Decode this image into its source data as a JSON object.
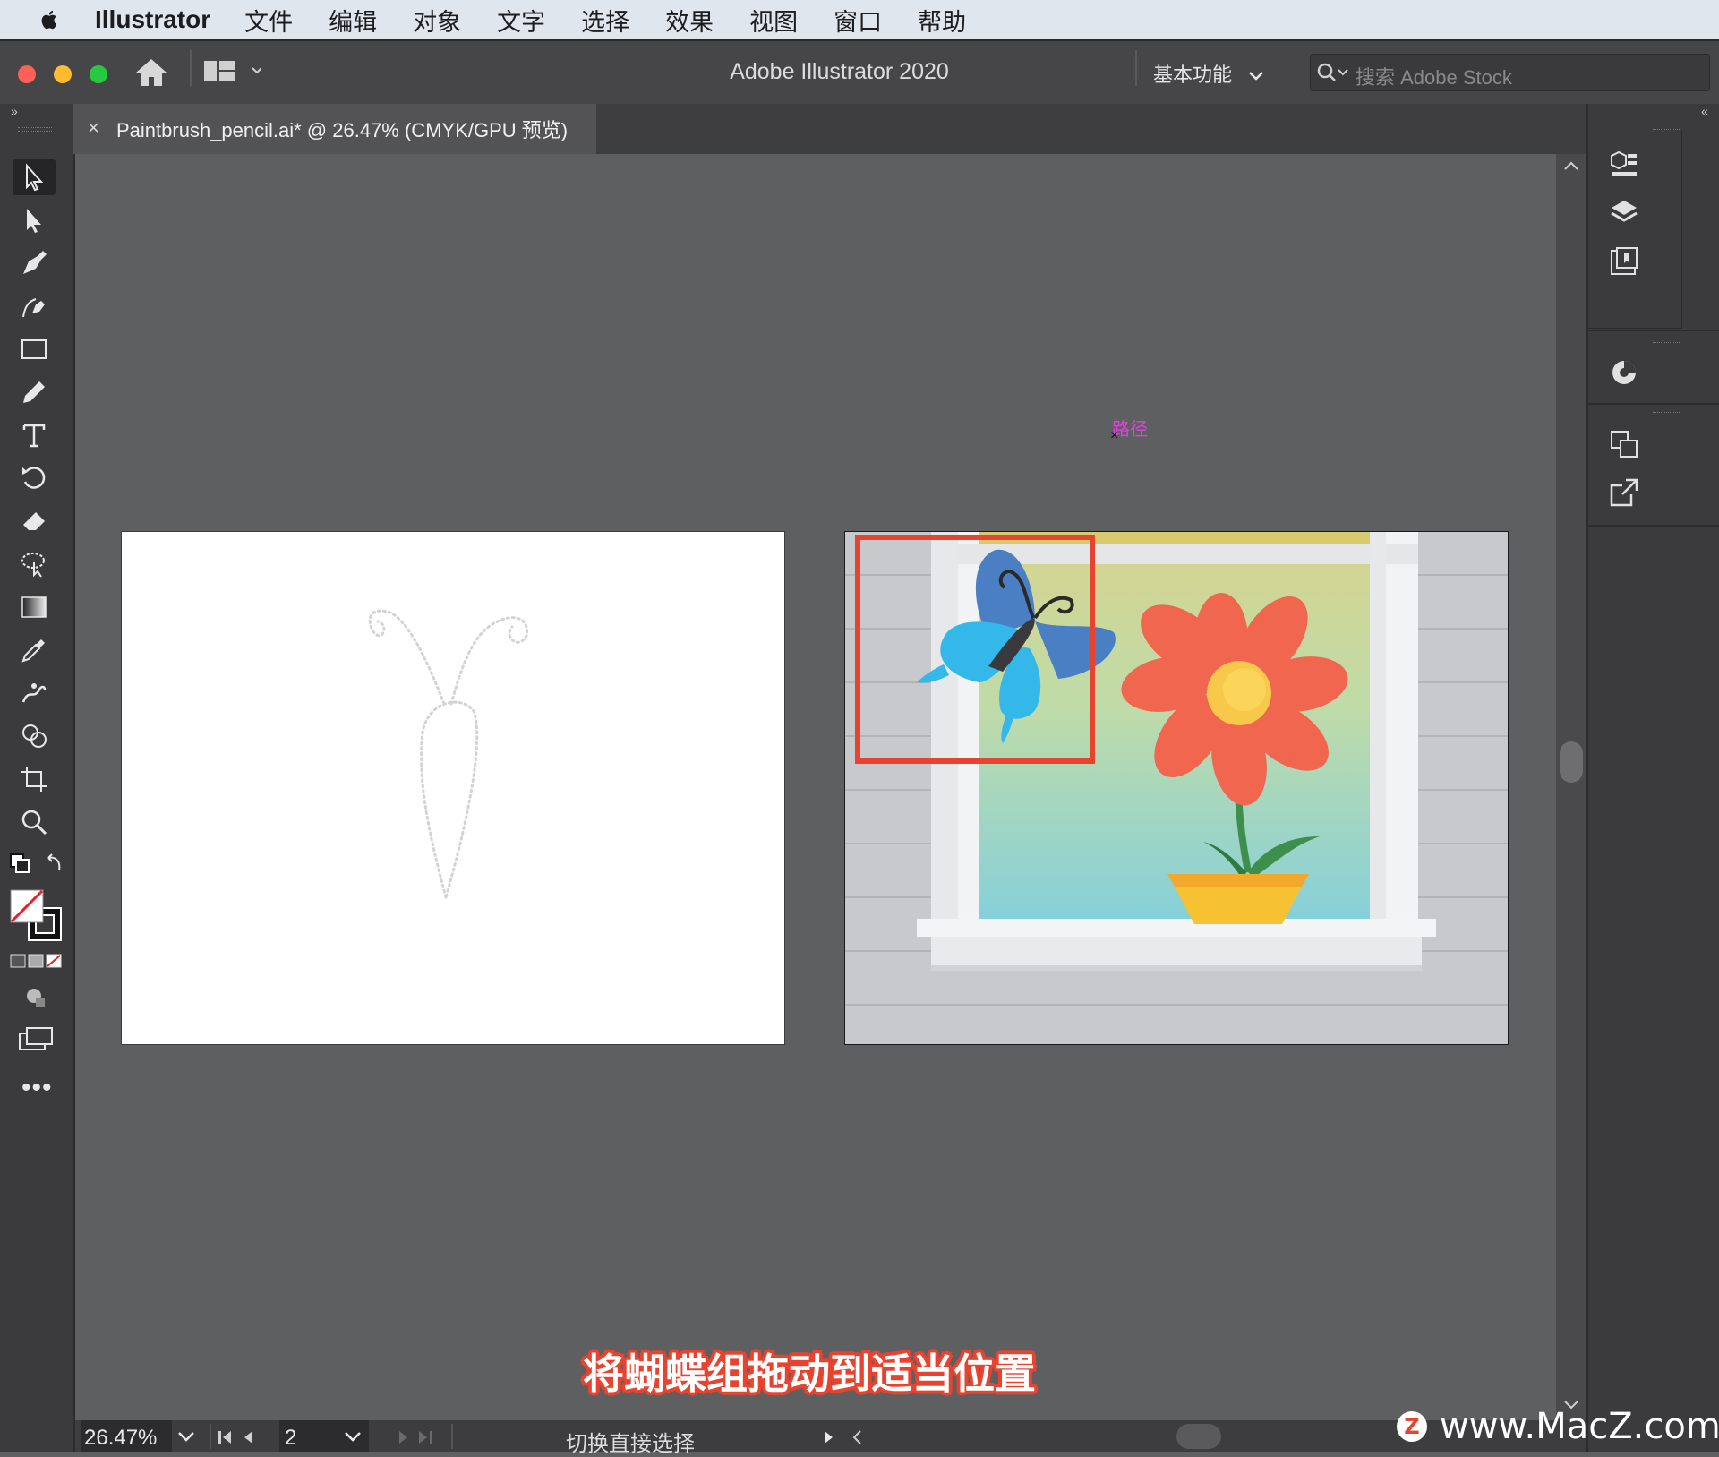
{
  "menubar": {
    "app_name": "Illustrator",
    "items": [
      "文件",
      "编辑",
      "对象",
      "文字",
      "选择",
      "效果",
      "视图",
      "窗口",
      "帮助"
    ]
  },
  "appbar": {
    "title": "Adobe Illustrator 2020",
    "workspace": "基本功能",
    "search_placeholder": "搜索 Adobe Stock"
  },
  "document_tab": {
    "close": "×",
    "label": "Paintbrush_pencil.ai* @ 26.47% (CMYK/GPU 预览)"
  },
  "canvas": {
    "path_hint": "路径",
    "path_marker": "×"
  },
  "statusbar": {
    "zoom": "26.47%",
    "artboard_number": "2",
    "status_text": "切换直接选择"
  },
  "caption": "将蝴蝶组拖动到适当位置",
  "watermark": "www.MacZ.com",
  "colors": {
    "highlight_box": "#e8432f",
    "butterfly_light": "#34b8ea",
    "butterfly_dark": "#4a7fc4",
    "flower": "#f0664f",
    "flower_center": "#f8c84a",
    "pot": "#f6b634",
    "stem": "#3e8e4e"
  },
  "icons": [
    "apple-icon",
    "home-icon",
    "workspace-layout-icon",
    "search-icon",
    "selection-tool-icon",
    "direct-selection-tool-icon",
    "pen-tool-icon",
    "curvature-tool-icon",
    "rectangle-tool-icon",
    "pencil-tool-icon",
    "type-tool-icon",
    "rotate-tool-icon",
    "eraser-tool-icon",
    "lasso-tool-icon",
    "gradient-tool-icon",
    "eyedropper-tool-icon",
    "puppet-warp-tool-icon",
    "shape-builder-tool-icon",
    "artboard-tool-icon",
    "zoom-tool-icon",
    "properties-panel-icon",
    "layers-panel-icon",
    "libraries-panel-icon",
    "color-panel-icon",
    "transform-panel-icon",
    "export-panel-icon"
  ]
}
